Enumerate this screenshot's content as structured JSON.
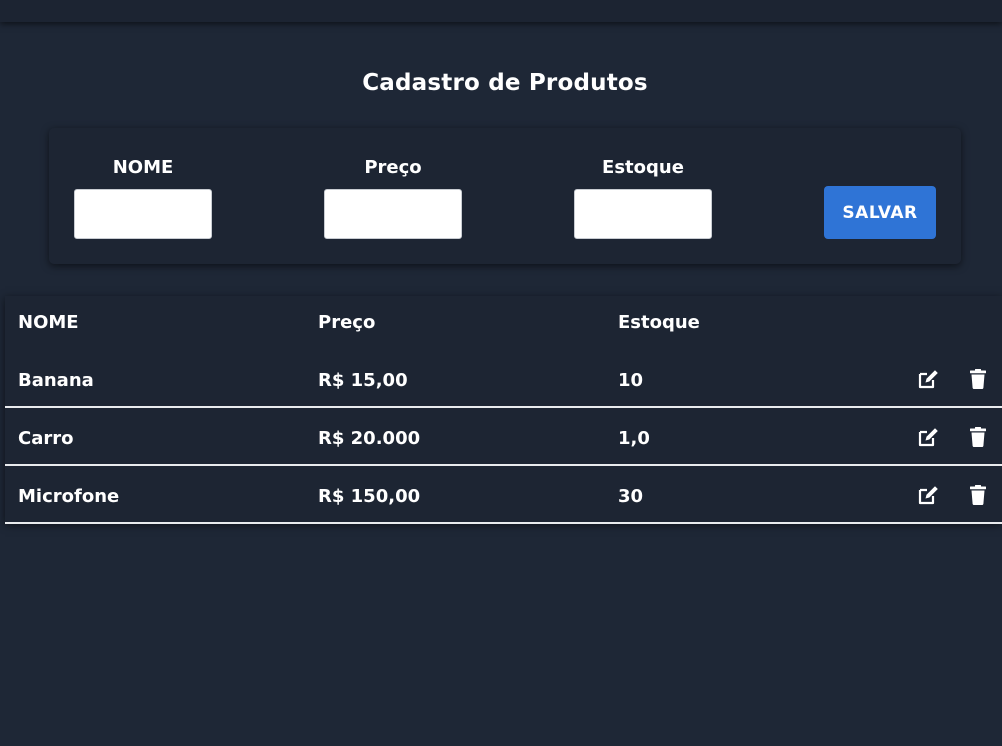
{
  "page": {
    "title": "Cadastro de Produtos"
  },
  "form": {
    "fields": [
      {
        "label": "NOME",
        "value": "",
        "placeholder": ""
      },
      {
        "label": "Preço",
        "value": "",
        "placeholder": ""
      },
      {
        "label": "Estoque",
        "value": "",
        "placeholder": ""
      }
    ],
    "save_label": "SALVAR"
  },
  "table": {
    "headers": [
      "NOME",
      "Preço",
      "Estoque"
    ],
    "rows": [
      {
        "nome": "Banana",
        "preco": "R$ 15,00",
        "estoque": "10"
      },
      {
        "nome": "Carro",
        "preco": "R$ 20.000",
        "estoque": "1,0"
      },
      {
        "nome": "Microfone",
        "preco": "R$ 150,00",
        "estoque": "30"
      }
    ],
    "row_actions": [
      "edit-icon",
      "trash-icon"
    ]
  },
  "colors": {
    "background": "#1e2736",
    "card": "#1d2533",
    "accent": "#2f74d6",
    "text": "#ffffff",
    "row_divider": "#e9ebee"
  }
}
